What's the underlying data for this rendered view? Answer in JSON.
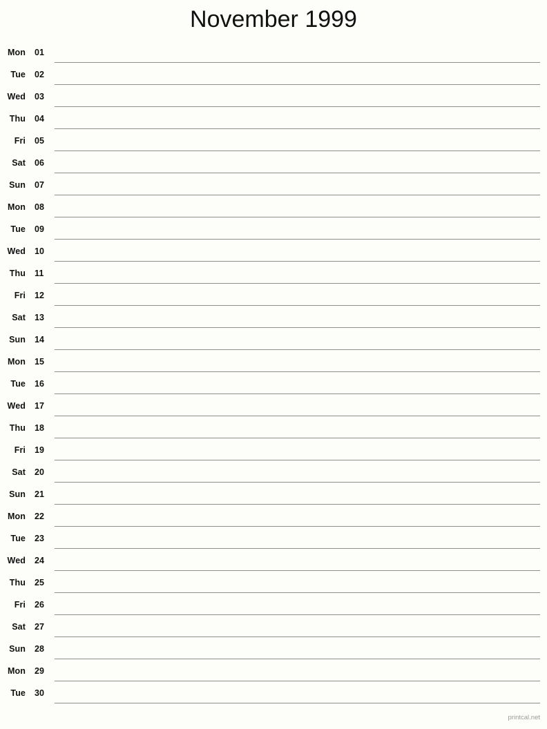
{
  "document": {
    "title": "November 1999",
    "month": "November",
    "year": "1999",
    "footer": "printcal.net",
    "background_color": "#fdfdfa",
    "line_color": "#8c8c8c",
    "text_color": "#111111",
    "footer_color": "#9a9a9a"
  },
  "days": [
    {
      "weekday": "Mon",
      "number": "01"
    },
    {
      "weekday": "Tue",
      "number": "02"
    },
    {
      "weekday": "Wed",
      "number": "03"
    },
    {
      "weekday": "Thu",
      "number": "04"
    },
    {
      "weekday": "Fri",
      "number": "05"
    },
    {
      "weekday": "Sat",
      "number": "06"
    },
    {
      "weekday": "Sun",
      "number": "07"
    },
    {
      "weekday": "Mon",
      "number": "08"
    },
    {
      "weekday": "Tue",
      "number": "09"
    },
    {
      "weekday": "Wed",
      "number": "10"
    },
    {
      "weekday": "Thu",
      "number": "11"
    },
    {
      "weekday": "Fri",
      "number": "12"
    },
    {
      "weekday": "Sat",
      "number": "13"
    },
    {
      "weekday": "Sun",
      "number": "14"
    },
    {
      "weekday": "Mon",
      "number": "15"
    },
    {
      "weekday": "Tue",
      "number": "16"
    },
    {
      "weekday": "Wed",
      "number": "17"
    },
    {
      "weekday": "Thu",
      "number": "18"
    },
    {
      "weekday": "Fri",
      "number": "19"
    },
    {
      "weekday": "Sat",
      "number": "20"
    },
    {
      "weekday": "Sun",
      "number": "21"
    },
    {
      "weekday": "Mon",
      "number": "22"
    },
    {
      "weekday": "Tue",
      "number": "23"
    },
    {
      "weekday": "Wed",
      "number": "24"
    },
    {
      "weekday": "Thu",
      "number": "25"
    },
    {
      "weekday": "Fri",
      "number": "26"
    },
    {
      "weekday": "Sat",
      "number": "27"
    },
    {
      "weekday": "Sun",
      "number": "28"
    },
    {
      "weekday": "Mon",
      "number": "29"
    },
    {
      "weekday": "Tue",
      "number": "30"
    }
  ]
}
